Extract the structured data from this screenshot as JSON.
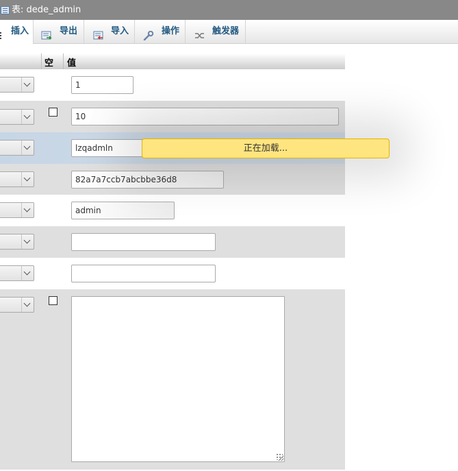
{
  "window": {
    "title": "表: dede_admin",
    "title_icon": "table-icon"
  },
  "tabs": [
    {
      "label": "插入",
      "icon": "insert-icon",
      "active": true
    },
    {
      "label": "导出",
      "icon": "export-icon",
      "active": false
    },
    {
      "label": "导入",
      "icon": "import-icon",
      "active": false
    },
    {
      "label": "操作",
      "icon": "wrench-icon",
      "active": false
    },
    {
      "label": "触发器",
      "icon": "trigger-icon",
      "active": false
    }
  ],
  "table": {
    "headers": {
      "null": "空",
      "value": "值"
    },
    "rows": [
      {
        "value": "1",
        "null_checkbox": false
      },
      {
        "value": "10",
        "null_checkbox": true
      },
      {
        "value": "lzqadmln",
        "null_checkbox": false
      },
      {
        "value": "82a7a7ccb7abcbbe36d8",
        "null_checkbox": false
      },
      {
        "value": "admin",
        "null_checkbox": false
      },
      {
        "value": "",
        "null_checkbox": false
      },
      {
        "value": "",
        "null_checkbox": false
      },
      {
        "value": "",
        "null_checkbox": true
      }
    ]
  },
  "loading": {
    "text": "正在加载..."
  },
  "colors": {
    "link": "#235a81",
    "loading_bg": "#ffe57f",
    "row_alt": "#dfdfdf"
  }
}
